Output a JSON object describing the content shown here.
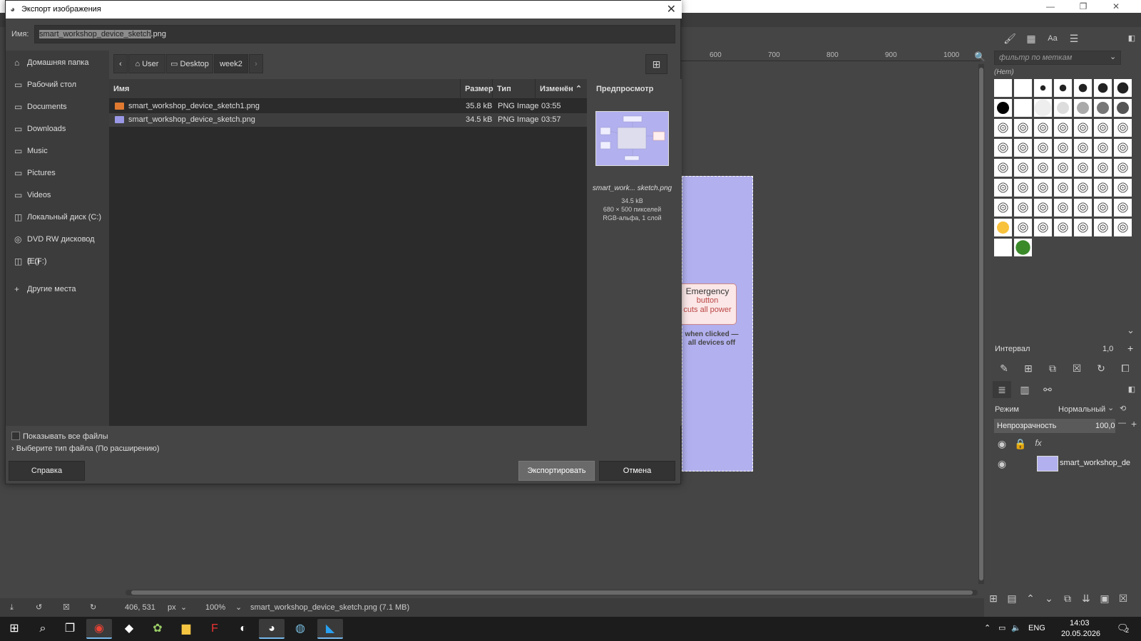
{
  "dialog": {
    "title": "Экспорт изображения",
    "name_label": "Имя:",
    "filename_selected": "smart_workshop_device_sketch",
    "filename_rest": ".png",
    "places": [
      {
        "label": "Домашняя папка",
        "icon": "home-icon"
      },
      {
        "label": "Рабочий стол",
        "icon": "folder-icon"
      },
      {
        "label": "Documents",
        "icon": "folder-icon"
      },
      {
        "label": "Downloads",
        "icon": "folder-icon"
      },
      {
        "label": "Music",
        "icon": "folder-icon"
      },
      {
        "label": "Pictures",
        "icon": "folder-icon"
      },
      {
        "label": "Videos",
        "icon": "folder-icon"
      },
      {
        "label": "Локальный диск (C:)",
        "icon": "drive-icon"
      },
      {
        "label": "DVD RW дисковод (E:)",
        "icon": "dvd-icon"
      },
      {
        "label": "E (F:)",
        "icon": "drive-icon"
      },
      {
        "label": "Другие места",
        "icon": "plus-icon"
      }
    ],
    "path": [
      "User",
      "Desktop",
      "week2"
    ],
    "columns": {
      "name": "Имя",
      "size": "Размер",
      "type": "Тип",
      "modified": "Изменён"
    },
    "files": [
      {
        "name": "smart_workshop_device_sketch1.png",
        "size": "35.8 kB",
        "type": "PNG Image",
        "modified": "03:55",
        "icon_color": "#e07a30"
      },
      {
        "name": "smart_workshop_device_sketch.png",
        "size": "34.5 kB",
        "type": "PNG Image",
        "modified": "03:57",
        "icon_color": "#9a98e6"
      }
    ],
    "preview": {
      "title": "Предпросмотр",
      "name": "smart_work... sketch.png",
      "size": "34.5 kB",
      "dims": "680 × 500 пикселей",
      "mode": "RGB-альфа, 1 слой"
    },
    "show_all_files": "Показывать все файлы",
    "file_type": "Выберите тип файла (По расширению)",
    "help_btn": "Справка",
    "export_btn": "Экспортировать",
    "cancel_btn": "Отмена"
  },
  "canvas": {
    "ruler_ticks": [
      "600",
      "700",
      "800",
      "900",
      "1000"
    ],
    "emergency_title": "Emergency",
    "emergency_line2": "button",
    "emergency_line3": "cuts all power",
    "note_line1": "when clicked —",
    "note_line2": "all devices off",
    "image_color": "#b2b0ee"
  },
  "statusbar": {
    "coords": "406, 531",
    "unit": "px",
    "zoom": "100%",
    "file_info": "smart_workshop_device_sketch.png (7.1 MB)"
  },
  "right_dock": {
    "brush_filter": "фильтр по меткам",
    "brush_none": "(Нет)",
    "interval_label": "Интервал",
    "interval_value": "1,0",
    "mode_label": "Режим",
    "mode_value": "Нормальный",
    "opacity_label": "Непрозрачность",
    "opacity_value": "100,0",
    "layer_name": "smart_workshop_de"
  },
  "taskbar": {
    "time": "14:03",
    "date": "20.05.2026",
    "lang": "ENG",
    "notifications": "2"
  }
}
